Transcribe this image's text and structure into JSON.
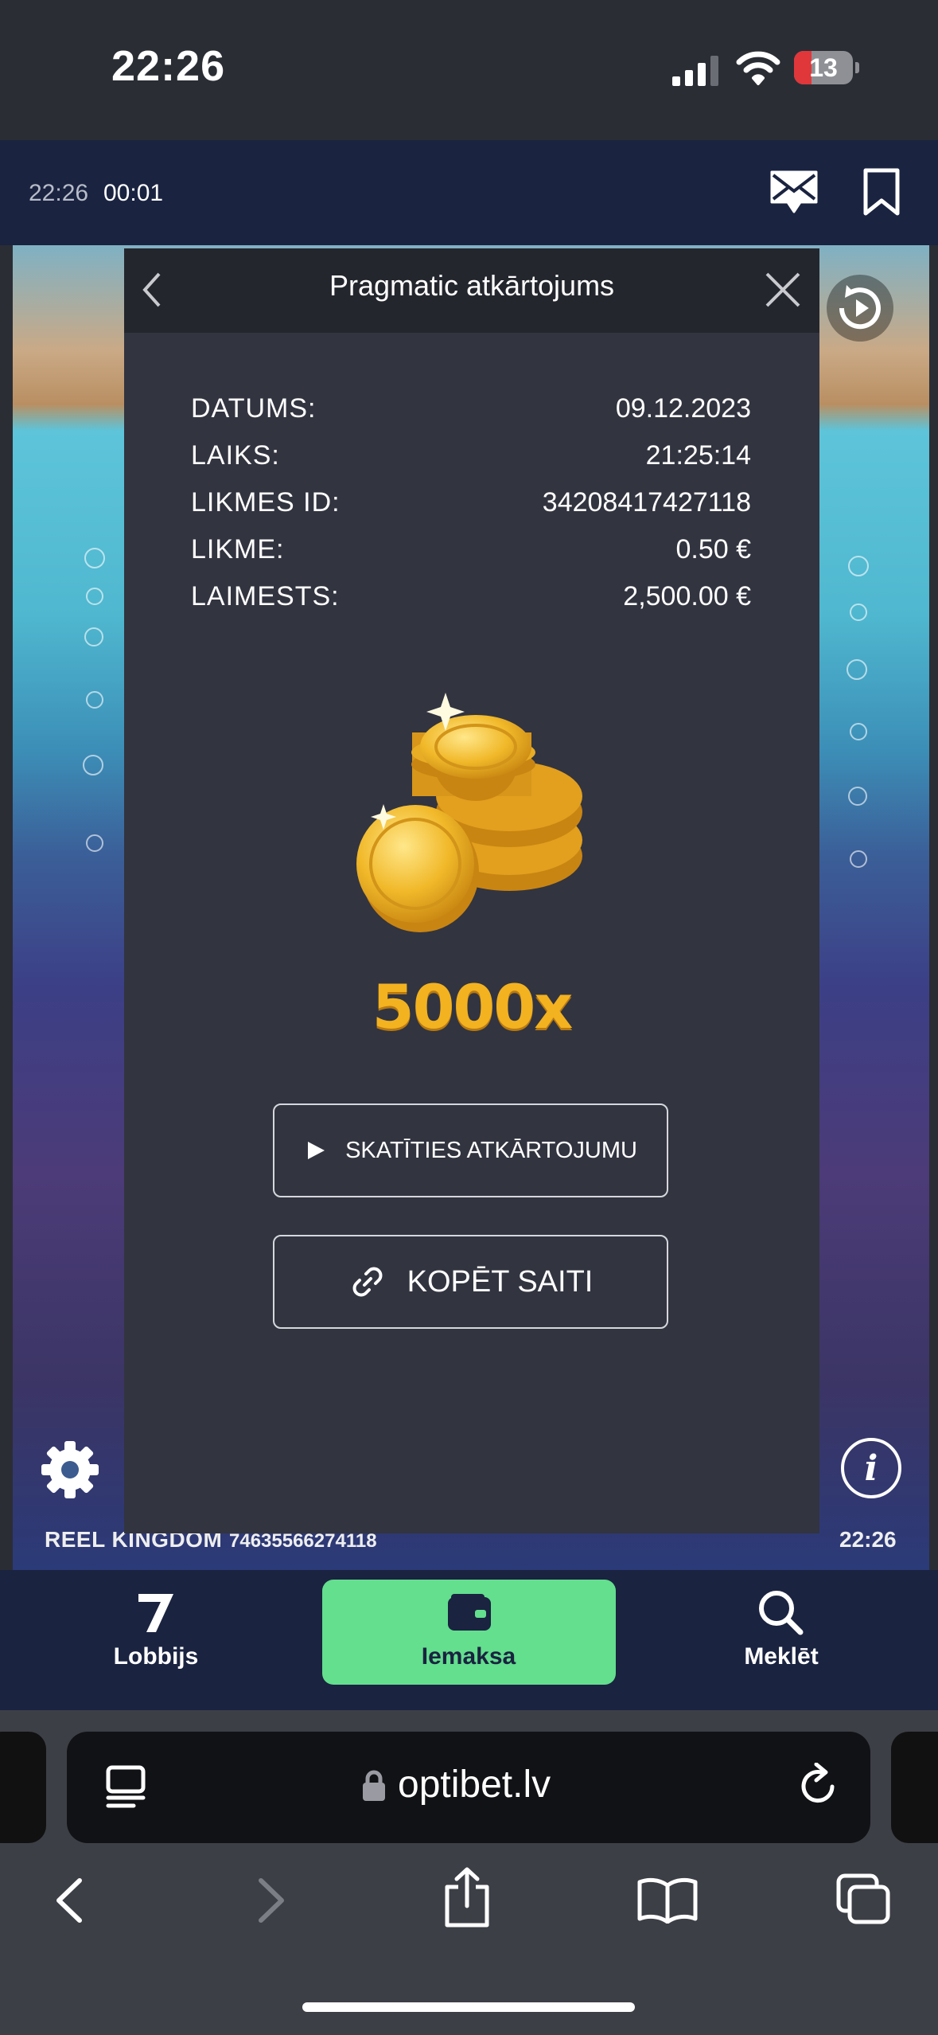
{
  "status_bar": {
    "time": "22:26",
    "battery": "13"
  },
  "site_header": {
    "time": "22:26",
    "session_timer": "00:01"
  },
  "modal": {
    "title": "Pragmatic atkārtojums",
    "rows": [
      {
        "label": "DATUMS:",
        "value": "09.12.2023"
      },
      {
        "label": "LAIKS:",
        "value": "21:25:14"
      },
      {
        "label": "LIKMES ID:",
        "value": "34208417427118"
      },
      {
        "label": "LIKME:",
        "value": "0.50 €"
      },
      {
        "label": "LAIMESTS:",
        "value": "2,500.00 €"
      }
    ],
    "multiplier": "5000x",
    "watch_button": "SKATĪTIES ATKĀRTOJUMU",
    "copy_button": "KOPĒT SAITI"
  },
  "game": {
    "provider": "REEL KINGDOM",
    "round_id": "74635566274118",
    "time": "22:26"
  },
  "app_nav": {
    "items": [
      {
        "label": "Lobbijs"
      },
      {
        "label": "Iemaksa"
      },
      {
        "label": "Meklēt"
      }
    ],
    "active": "Iemaksa",
    "active_color": "#63df8e"
  },
  "browser": {
    "url": "optibet.lv"
  }
}
